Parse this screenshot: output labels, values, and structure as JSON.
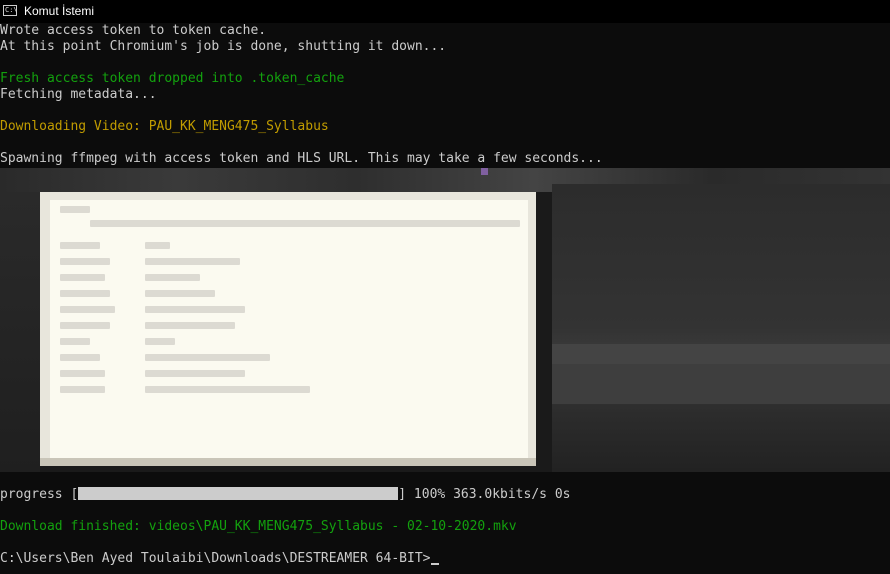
{
  "window": {
    "title": "Komut İstemi",
    "icon": "cmd-icon",
    "icon_text": "C:\\"
  },
  "console": {
    "lines": [
      "Wrote access token to token cache.",
      "At this point Chromium's job is done, shutting it down...",
      "Fresh access token dropped into .token_cache",
      "Fetching metadata...",
      "Downloading Video: PAU_KK_MENG475_Syllabus",
      "Spawning ffmpeg with access token and HLS URL. This may take a few seconds..."
    ],
    "progress": {
      "prefix": "progress [",
      "suffix": "] 100% 363.0kbits/s 0s",
      "fraction": 1.0
    },
    "finished": "Download finished: videos\\PAU_KK_MENG475_Syllabus - 02-10-2020.mkv",
    "prompt": "C:\\Users\\Ben Ayed Toulaibi\\Downloads\\DESTREAMER 64-BIT>"
  },
  "colors": {
    "background": "#0c0c0c",
    "text": "#cccccc",
    "green": "#13a10e",
    "yellow": "#c19c00"
  }
}
